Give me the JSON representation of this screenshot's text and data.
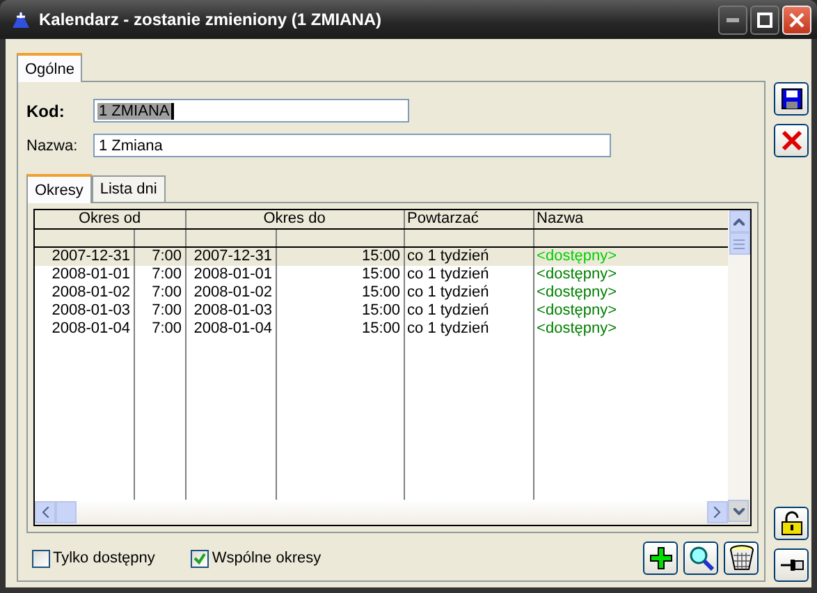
{
  "window": {
    "title": "Kalendarz - zostanie zmieniony  (1 ZMIANA)"
  },
  "tabs": [
    {
      "label": "Ogólne",
      "selected": true
    }
  ],
  "fields": [
    {
      "label": "Kod:",
      "value": "1 ZMIANA",
      "focused": true,
      "required": true
    },
    {
      "label": "Nazwa:",
      "value": "1 Zmiana",
      "focused": false,
      "required": false
    }
  ],
  "subtabs": [
    {
      "label": "Okresy",
      "selected": true
    },
    {
      "label": "Lista dni",
      "selected": false
    }
  ],
  "table": {
    "columns": [
      "Okres od",
      "Okres do",
      "Powtarzać",
      "Nazwa"
    ],
    "rows": [
      {
        "from_date": "2007-12-31",
        "from_time": "7:00",
        "to_date": "2007-12-31",
        "to_time": "15:00",
        "repeat": "co 1 tydzień",
        "name": "<dostępny>",
        "selected": true
      },
      {
        "from_date": "2008-01-01",
        "from_time": "7:00",
        "to_date": "2008-01-01",
        "to_time": "15:00",
        "repeat": "co 1 tydzień",
        "name": "<dostępny>",
        "selected": false
      },
      {
        "from_date": "2008-01-02",
        "from_time": "7:00",
        "to_date": "2008-01-02",
        "to_time": "15:00",
        "repeat": "co 1 tydzień",
        "name": "<dostępny>",
        "selected": false
      },
      {
        "from_date": "2008-01-03",
        "from_time": "7:00",
        "to_date": "2008-01-03",
        "to_time": "15:00",
        "repeat": "co 1 tydzień",
        "name": "<dostępny>",
        "selected": false
      },
      {
        "from_date": "2008-01-04",
        "from_time": "7:00",
        "to_date": "2008-01-04",
        "to_time": "15:00",
        "repeat": "co 1 tydzień",
        "name": "<dostępny>",
        "selected": false
      }
    ]
  },
  "checkboxes": [
    {
      "label": "Tylko dostępny",
      "checked": false
    },
    {
      "label": "Wspólne okresy",
      "checked": true
    }
  ]
}
